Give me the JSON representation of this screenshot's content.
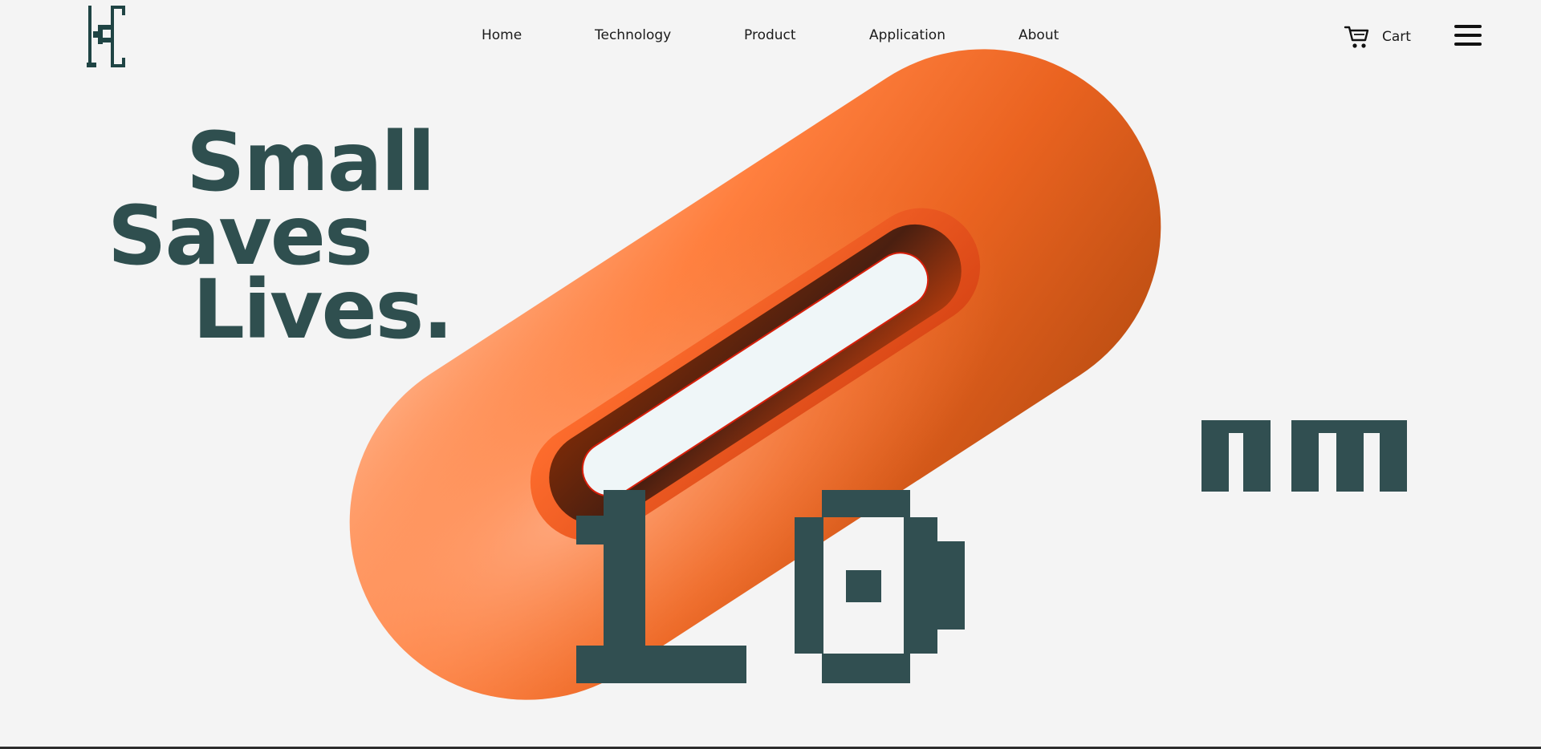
{
  "header": {
    "logo_icon": "brand-monogram-icon",
    "nav": [
      {
        "label": "Home"
      },
      {
        "label": "Technology"
      },
      {
        "label": "Product"
      },
      {
        "label": "Application"
      },
      {
        "label": "About"
      }
    ],
    "cart": {
      "label": "Cart",
      "icon": "cart-icon"
    },
    "menu_icon": "hamburger-menu-icon"
  },
  "hero": {
    "headline_lines": [
      "Small",
      "Saves",
      "Lives."
    ],
    "visual_icon": "orange-capsule-illustration",
    "size_value": "10",
    "size_unit": "nm"
  },
  "colors": {
    "background": "#f4f4f4",
    "brand_dark": "#2f4f4f",
    "accent_orange": "#ff7a35",
    "capsule_window": "#eff6f8"
  }
}
